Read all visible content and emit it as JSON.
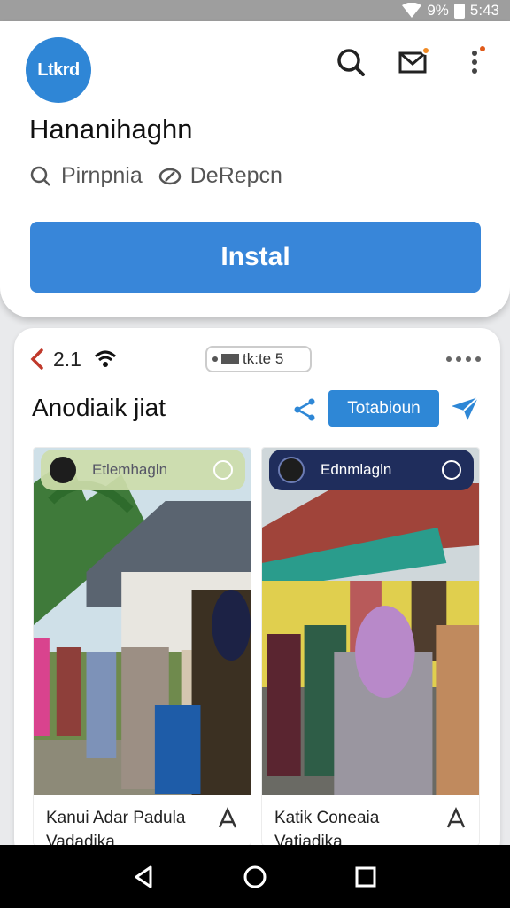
{
  "status_bar": {
    "battery_text": "9%",
    "time": "5:43"
  },
  "header": {
    "logo_text": "Ltkrd",
    "app_title": "Hananihaghn",
    "meta": [
      {
        "icon": "search-icon",
        "label": "Pirnpnia"
      },
      {
        "icon": "link-icon",
        "label": "DeRepcn"
      }
    ],
    "install_label": "Instal",
    "icons": [
      "search-icon",
      "mail-icon",
      "more-vert-icon"
    ]
  },
  "card": {
    "version": "2.1",
    "pill_label": "tk:te 5",
    "title": "Anodiaik jiat",
    "tab_button_label": "Totabioun",
    "tiles": [
      {
        "badge": "Etlemhagln",
        "caption": "Kanui Adar Padula Vadadika"
      },
      {
        "badge": "Ednmlagln",
        "caption": "Katik Coneaia Vatiadika"
      }
    ]
  },
  "colors": {
    "accent": "#3886d9",
    "badge_dark": "#1f2d5c",
    "notif_dot": "#f08a24"
  }
}
